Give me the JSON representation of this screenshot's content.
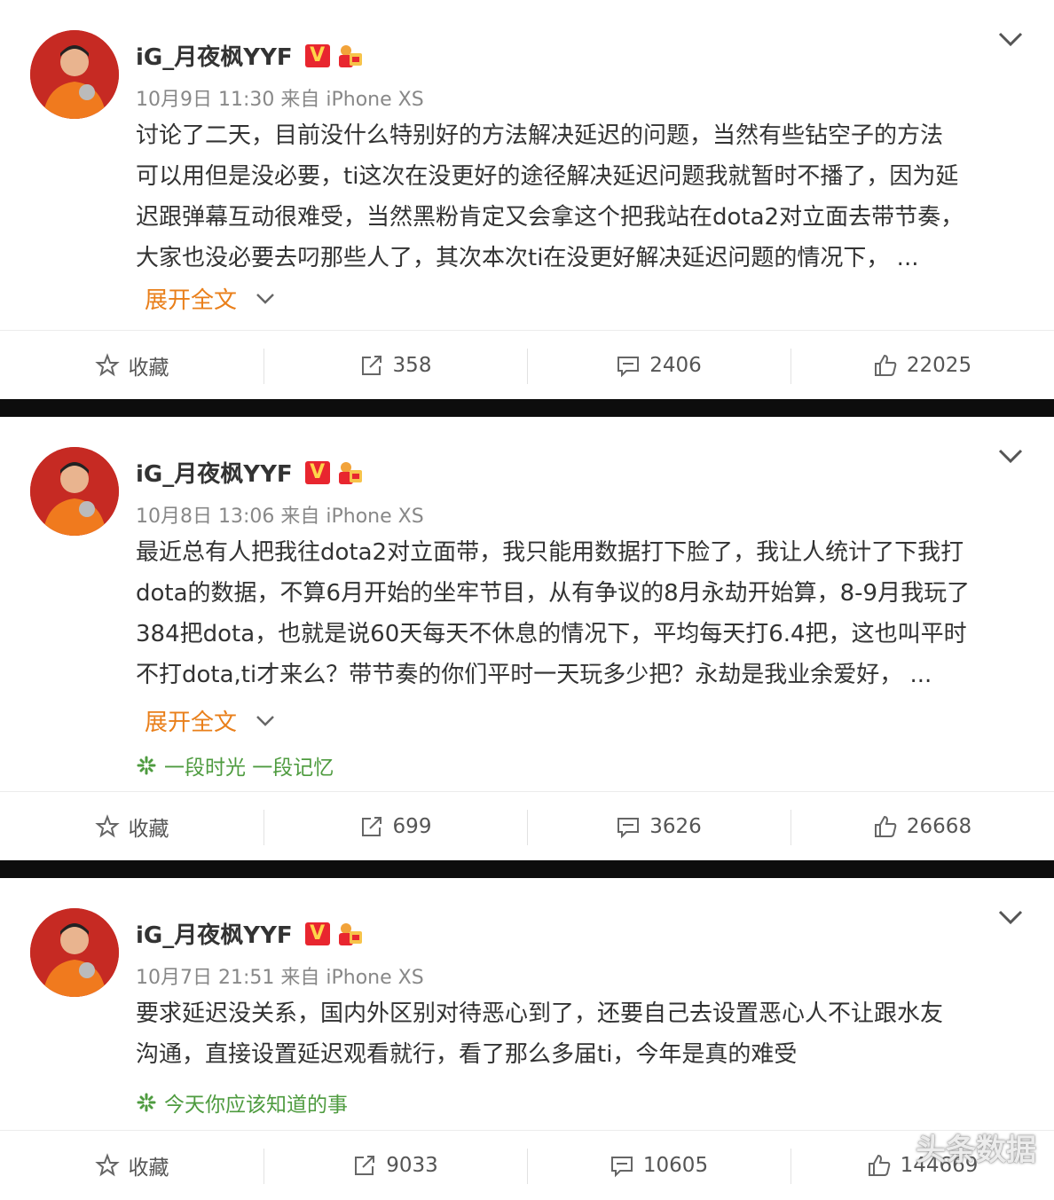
{
  "posts": [
    {
      "username": "iG_月夜枫YYF",
      "verified": "V",
      "meta": "10月9日 11:30 来自 iPhone XS",
      "lines": [
        "讨论了二天，目前没什么特别好的方法解决延迟的问题，当然有些钻空子的方法",
        "可以用但是没必要，ti这次在没更好的途径解决延迟问题我就暂时不播了，因为延",
        "迟跟弹幕互动很难受，当然黑粉肯定又会拿这个把我站在dota2对立面去带节奏，",
        "大家也没必要去叼那些人了，其次本次ti在没更好解决延迟问题的情况下，  ..."
      ],
      "expand": "展开全文",
      "topic": "",
      "actions": {
        "favorite": "收藏",
        "repost": "358",
        "comment": "2406",
        "like": "22025"
      }
    },
    {
      "username": "iG_月夜枫YYF",
      "verified": "V",
      "meta": "10月8日 13:06 来自 iPhone XS",
      "lines": [
        "最近总有人把我往dota2对立面带，我只能用数据打下脸了，我让人统计了下我打",
        "dota的数据，不算6月开始的坐牢节目，从有争议的8月永劫开始算，8-9月我玩了",
        "384把dota，也就是说60天每天不休息的情况下，平均每天打6.4把，这也叫平时",
        "不打dota,ti才来么？带节奏的你们平时一天玩多少把？永劫是我业余爱好，  ..."
      ],
      "expand": "展开全文",
      "topic": "一段时光 一段记忆",
      "actions": {
        "favorite": "收藏",
        "repost": "699",
        "comment": "3626",
        "like": "26668"
      }
    },
    {
      "username": "iG_月夜枫YYF",
      "verified": "V",
      "meta": "10月7日 21:51 来自 iPhone XS",
      "lines": [
        "要求延迟没关系，国内外区别对待恶心到了，还要自己去设置恶心人不让跟水友",
        "沟通，直接设置延迟观看就行，看了那么多届ti，今年是真的难受"
      ],
      "expand": "",
      "topic": "今天你应该知道的事",
      "actions": {
        "favorite": "收藏",
        "repost": "9033",
        "comment": "10605",
        "like": "144669"
      }
    }
  ],
  "watermark": "头条数据",
  "colors": {
    "expand": "#e97f1a",
    "topic": "#4e9b3f",
    "badge": "#e8262f",
    "divider": "#0d0d0d"
  }
}
